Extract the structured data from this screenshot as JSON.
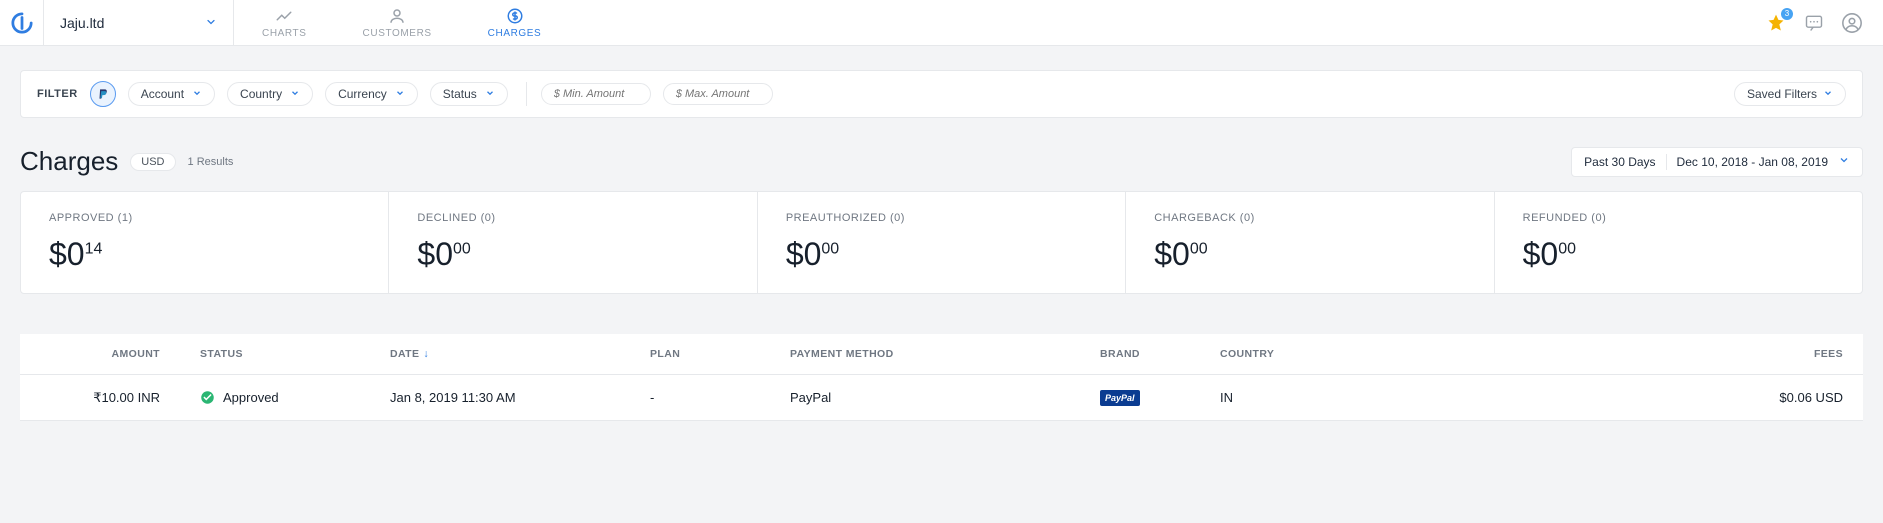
{
  "org": {
    "name": "Jaju.ltd"
  },
  "nav": {
    "tabs": [
      {
        "label": "CHARTS"
      },
      {
        "label": "CUSTOMERS"
      },
      {
        "label": "CHARGES"
      }
    ],
    "active_index": 2,
    "notification_count": "3"
  },
  "filter": {
    "label": "FILTER",
    "pills": [
      {
        "label": "Account"
      },
      {
        "label": "Country"
      },
      {
        "label": "Currency"
      },
      {
        "label": "Status"
      }
    ],
    "min_placeholder": "$ Min. Amount",
    "max_placeholder": "$ Max. Amount",
    "saved_label": "Saved Filters"
  },
  "header": {
    "title": "Charges",
    "currency_badge": "USD",
    "results_text": "1 Results",
    "date_preset": "Past 30 Days",
    "date_range": "Dec 10, 2018 - Jan 08, 2019"
  },
  "stats": [
    {
      "label": "APPROVED  (1)",
      "whole": "$0",
      "cents": "14"
    },
    {
      "label": "DECLINED  (0)",
      "whole": "$0",
      "cents": "00"
    },
    {
      "label": "PREAUTHORIZED  (0)",
      "whole": "$0",
      "cents": "00"
    },
    {
      "label": "CHARGEBACK  (0)",
      "whole": "$0",
      "cents": "00"
    },
    {
      "label": "REFUNDED  (0)",
      "whole": "$0",
      "cents": "00"
    }
  ],
  "table": {
    "columns": {
      "amount": "AMOUNT",
      "status": "STATUS",
      "date": "DATE",
      "plan": "PLAN",
      "payment_method": "PAYMENT METHOD",
      "brand": "BRAND",
      "country": "COUNTRY",
      "fees": "FEES"
    },
    "rows": [
      {
        "amount": "₹10.00 INR",
        "status": "Approved",
        "date": "Jan 8, 2019 11:30 AM",
        "plan": "-",
        "payment_method": "PayPal",
        "brand": "PayPal",
        "country": "IN",
        "fees": "$0.06 USD"
      }
    ]
  }
}
